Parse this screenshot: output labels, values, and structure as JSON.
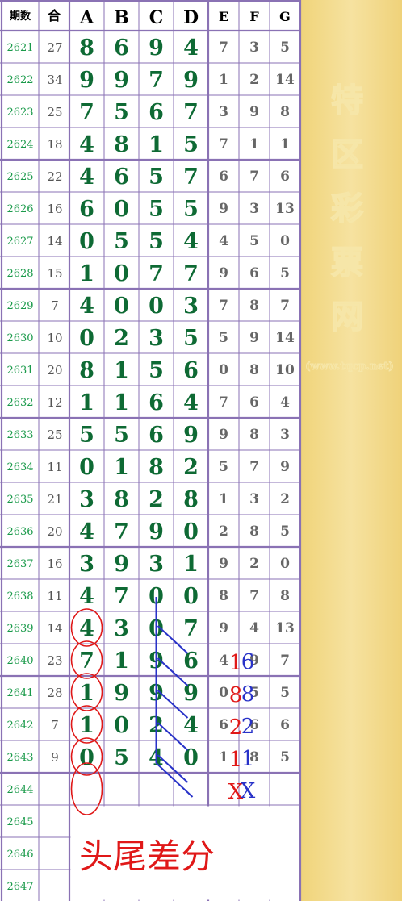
{
  "headers": {
    "period": "期数",
    "he": "合",
    "cols": [
      "A",
      "B",
      "C",
      "D",
      "E",
      "F",
      "G"
    ]
  },
  "rows": [
    {
      "p": "2621",
      "he": "27",
      "abcd": [
        "8",
        "6",
        "9",
        "4"
      ],
      "efg": [
        "7",
        "3",
        "5"
      ]
    },
    {
      "p": "2622",
      "he": "34",
      "abcd": [
        "9",
        "9",
        "7",
        "9"
      ],
      "efg": [
        "1",
        "2",
        "14"
      ]
    },
    {
      "p": "2623",
      "he": "25",
      "abcd": [
        "7",
        "5",
        "6",
        "7"
      ],
      "efg": [
        "3",
        "9",
        "8"
      ]
    },
    {
      "p": "2624",
      "he": "18",
      "abcd": [
        "4",
        "8",
        "1",
        "5"
      ],
      "efg": [
        "7",
        "1",
        "1"
      ]
    },
    {
      "p": "2625",
      "he": "22",
      "abcd": [
        "4",
        "6",
        "5",
        "7"
      ],
      "efg": [
        "6",
        "7",
        "6"
      ]
    },
    {
      "p": "2626",
      "he": "16",
      "abcd": [
        "6",
        "0",
        "5",
        "5"
      ],
      "efg": [
        "9",
        "3",
        "13"
      ]
    },
    {
      "p": "2627",
      "he": "14",
      "abcd": [
        "0",
        "5",
        "5",
        "4"
      ],
      "efg": [
        "4",
        "5",
        "0"
      ]
    },
    {
      "p": "2628",
      "he": "15",
      "abcd": [
        "1",
        "0",
        "7",
        "7"
      ],
      "efg": [
        "9",
        "6",
        "5"
      ]
    },
    {
      "p": "2629",
      "he": "7",
      "abcd": [
        "4",
        "0",
        "0",
        "3"
      ],
      "efg": [
        "7",
        "8",
        "7"
      ]
    },
    {
      "p": "2630",
      "he": "10",
      "abcd": [
        "0",
        "2",
        "3",
        "5"
      ],
      "efg": [
        "5",
        "9",
        "14"
      ]
    },
    {
      "p": "2631",
      "he": "20",
      "abcd": [
        "8",
        "1",
        "5",
        "6"
      ],
      "efg": [
        "0",
        "8",
        "10"
      ]
    },
    {
      "p": "2632",
      "he": "12",
      "abcd": [
        "1",
        "1",
        "6",
        "4"
      ],
      "efg": [
        "7",
        "6",
        "4"
      ]
    },
    {
      "p": "2633",
      "he": "25",
      "abcd": [
        "5",
        "5",
        "6",
        "9"
      ],
      "efg": [
        "9",
        "8",
        "3"
      ]
    },
    {
      "p": "2634",
      "he": "11",
      "abcd": [
        "0",
        "1",
        "8",
        "2"
      ],
      "efg": [
        "5",
        "7",
        "9"
      ]
    },
    {
      "p": "2635",
      "he": "21",
      "abcd": [
        "3",
        "8",
        "2",
        "8"
      ],
      "efg": [
        "1",
        "3",
        "2"
      ]
    },
    {
      "p": "2636",
      "he": "20",
      "abcd": [
        "4",
        "7",
        "9",
        "0"
      ],
      "efg": [
        "2",
        "8",
        "5"
      ]
    },
    {
      "p": "2637",
      "he": "16",
      "abcd": [
        "3",
        "9",
        "3",
        "1"
      ],
      "efg": [
        "9",
        "2",
        "0"
      ]
    },
    {
      "p": "2638",
      "he": "11",
      "abcd": [
        "4",
        "7",
        "0",
        "0"
      ],
      "efg": [
        "8",
        "7",
        "8"
      ]
    },
    {
      "p": "2639",
      "he": "14",
      "abcd": [
        "4",
        "3",
        "0",
        "7"
      ],
      "efg": [
        "9",
        "4",
        "13"
      ]
    },
    {
      "p": "2640",
      "he": "23",
      "abcd": [
        "7",
        "1",
        "9",
        "6"
      ],
      "efg": [
        "4",
        "9",
        "7"
      ]
    },
    {
      "p": "2641",
      "he": "28",
      "abcd": [
        "1",
        "9",
        "9",
        "9"
      ],
      "efg": [
        "0",
        "5",
        "5"
      ]
    },
    {
      "p": "2642",
      "he": "7",
      "abcd": [
        "1",
        "0",
        "2",
        "4"
      ],
      "efg": [
        "6",
        "6",
        "6"
      ]
    },
    {
      "p": "2643",
      "he": "9",
      "abcd": [
        "0",
        "5",
        "4",
        "0"
      ],
      "efg": [
        "1",
        "8",
        "5"
      ]
    },
    {
      "p": "2644",
      "he": "",
      "abcd": [
        "",
        "",
        "",
        ""
      ],
      "efg": [
        "",
        "",
        ""
      ]
    },
    {
      "p": "2645",
      "he": "",
      "abcd": [
        "",
        "",
        "",
        ""
      ],
      "efg": [
        "",
        "",
        ""
      ]
    },
    {
      "p": "2646",
      "he": "",
      "abcd": [
        "",
        "",
        "",
        ""
      ],
      "efg": [
        "",
        "",
        ""
      ]
    },
    {
      "p": "2647",
      "he": "",
      "abcd": [
        "",
        "",
        "",
        ""
      ],
      "efg": [
        "",
        "",
        ""
      ]
    }
  ],
  "watermark": {
    "chars": [
      "特",
      "区",
      "彩",
      "票",
      "网"
    ],
    "url": "(www.tqcp.net)"
  },
  "annotations": {
    "pairs": [
      {
        "red": "1",
        "blue": "6"
      },
      {
        "red": "8",
        "blue": "8"
      },
      {
        "red": "2",
        "blue": "2"
      },
      {
        "red": "1",
        "blue": "1"
      },
      {
        "red": "X",
        "blue": "X"
      }
    ],
    "title": "头尾差分"
  },
  "colors": {
    "grid": "#8a72b4",
    "digits": "#0e6a34",
    "period": "#1a9a4a",
    "side_panel": "#f3d98a",
    "red": "#e01818",
    "blue": "#2832c8"
  }
}
